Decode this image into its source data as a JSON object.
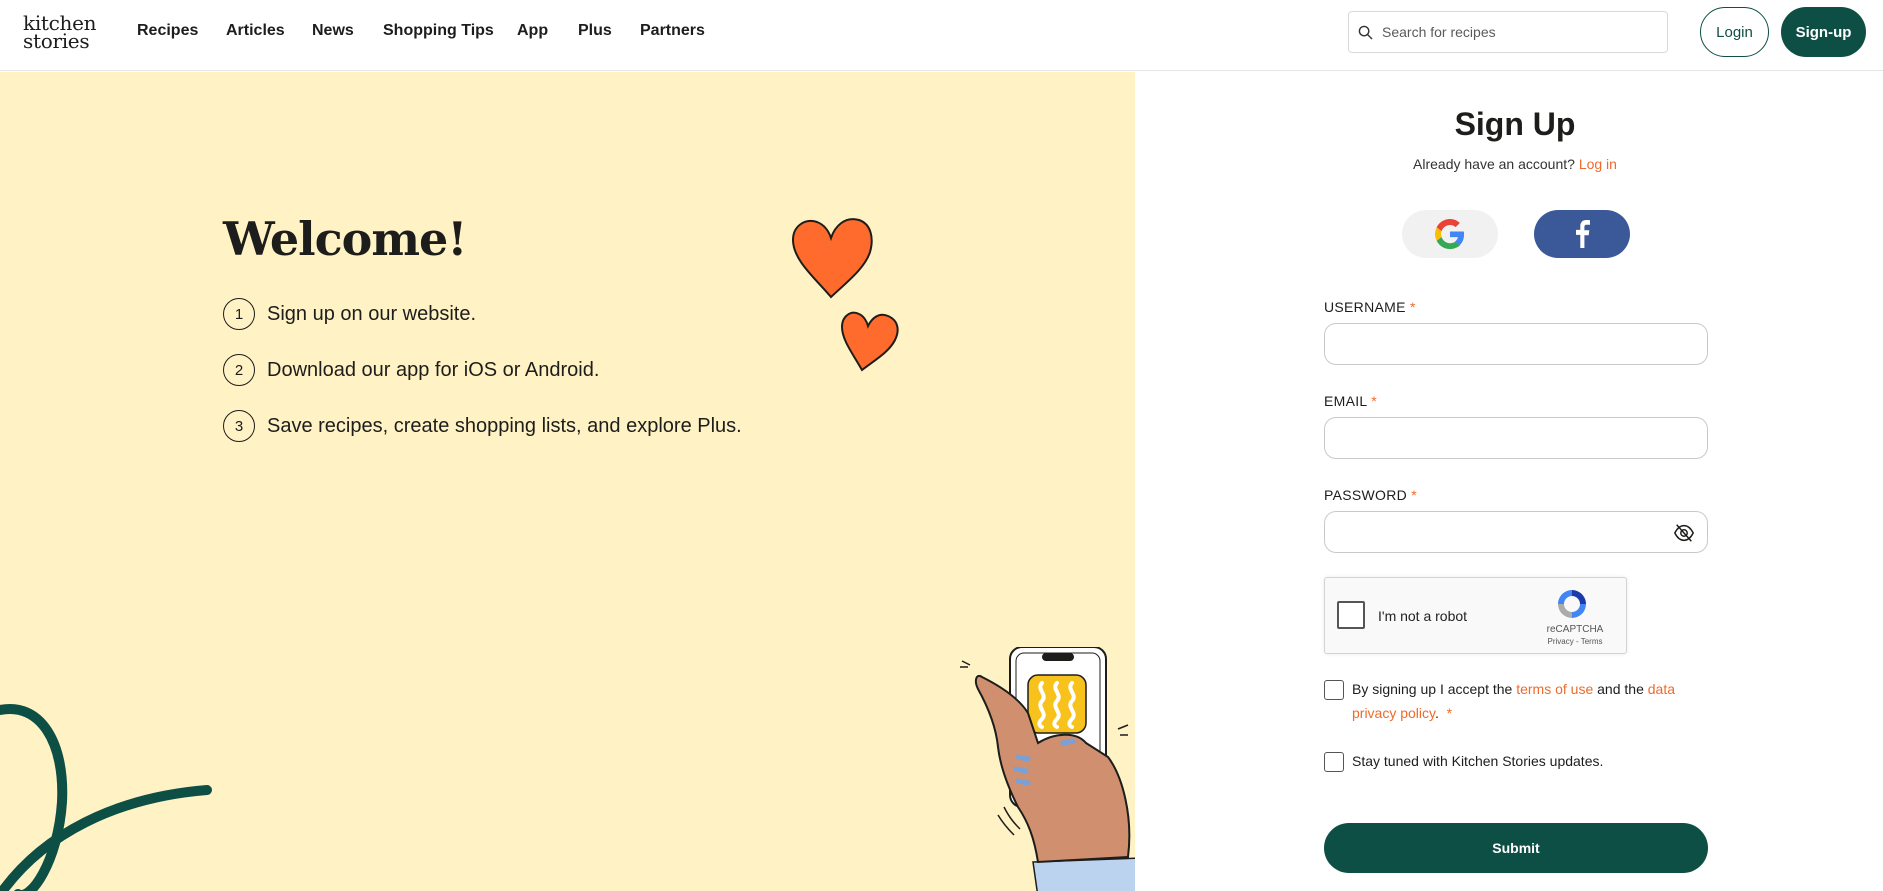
{
  "header": {
    "logo_line1": "kitchen",
    "logo_line2": "stories",
    "nav": [
      "Recipes",
      "Articles",
      "News",
      "Shopping Tips",
      "App",
      "Plus",
      "Partners"
    ],
    "search_placeholder": "Search for recipes",
    "login_label": "Login",
    "signup_label": "Sign-up"
  },
  "welcome": {
    "title": "Welcome!",
    "steps": [
      {
        "num": "1",
        "text": "Sign up on our website."
      },
      {
        "num": "2",
        "text": "Download our app for iOS or Android."
      },
      {
        "num": "3",
        "text": "Save recipes, create shopping lists, and explore Plus."
      }
    ]
  },
  "form": {
    "title": "Sign Up",
    "have_account": "Already have an account?",
    "login_link": "Log in",
    "username_label": "USERNAME",
    "email_label": "EMAIL",
    "password_label": "PASSWORD",
    "required_mark": "*",
    "captcha_text": "I'm not a robot",
    "captcha_brand": "reCAPTCHA",
    "captcha_privacy": "Privacy - Terms",
    "terms_pre": "By signing up I accept the",
    "terms_link": "terms of use",
    "terms_mid": "and the",
    "privacy_link": "data privacy policy",
    "terms_post": ".",
    "newsletter": "Stay tuned with Kitchen Stories updates.",
    "submit_label": "Submit"
  },
  "colors": {
    "brand_green": "#0e4f45",
    "accent_orange": "#ef6a2b",
    "panel_cream": "#fff2c5",
    "facebook_blue": "#3b5998"
  }
}
